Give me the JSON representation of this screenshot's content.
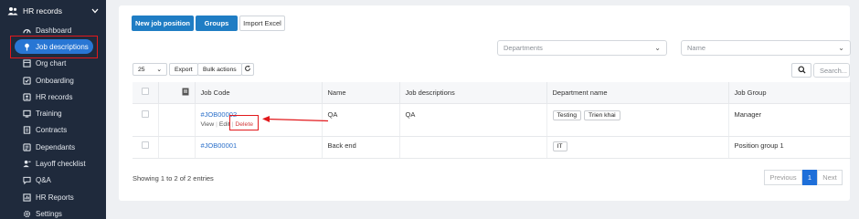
{
  "sidebar": {
    "header": {
      "label": "HR records",
      "icon": "people-icon"
    },
    "items": [
      {
        "label": "Dashboard",
        "icon": "dashboard-icon",
        "active": false
      },
      {
        "label": "Job descriptions",
        "icon": "pin-icon",
        "active": true
      },
      {
        "label": "Org chart",
        "icon": "org-chart-icon",
        "active": false
      },
      {
        "label": "Onboarding",
        "icon": "onboarding-icon",
        "active": false
      },
      {
        "label": "HR records",
        "icon": "id-card-icon",
        "active": false
      },
      {
        "label": "Training",
        "icon": "training-icon",
        "active": false
      },
      {
        "label": "Contracts",
        "icon": "contract-icon",
        "active": false
      },
      {
        "label": "Dependants",
        "icon": "dependants-icon",
        "active": false
      },
      {
        "label": "Layoff checklist",
        "icon": "user-minus-icon",
        "active": false
      },
      {
        "label": "Q&A",
        "icon": "qa-icon",
        "active": false
      },
      {
        "label": "HR Reports",
        "icon": "report-icon",
        "active": false
      },
      {
        "label": "Settings",
        "icon": "gear-icon",
        "active": false
      }
    ]
  },
  "toolbar": {
    "new_job_position": "New job position",
    "groups": "Groups",
    "import_excel": "Import Excel"
  },
  "filters": {
    "departments_placeholder": "Departments",
    "name_placeholder": "Name"
  },
  "table_controls": {
    "page_size": "25",
    "export": "Export",
    "bulk_actions": "Bulk actions",
    "search_placeholder": "Search..."
  },
  "table": {
    "columns": [
      "Job Code",
      "Name",
      "Job descriptions",
      "Department name",
      "Job Group"
    ],
    "rows": [
      {
        "code": "#JOB00002",
        "name": "QA",
        "description": "QA",
        "departments": [
          "Testing",
          "Trien khai"
        ],
        "group": "Manager",
        "actions": {
          "view": "View",
          "edit": "Edit",
          "delete": "Delete"
        }
      },
      {
        "code": "#JOB00001",
        "name": "Back end",
        "description": "",
        "departments": [
          "IT"
        ],
        "group": "Position group 1"
      }
    ]
  },
  "footer": {
    "summary": "Showing 1 to 2 of 2 entries",
    "previous": "Previous",
    "page": "1",
    "next": "Next"
  },
  "colors": {
    "sidebar_bg": "#1f2a3c",
    "primary": "#1f7dc4",
    "active_pill": "#2876d4",
    "highlight": "#e2191c"
  }
}
